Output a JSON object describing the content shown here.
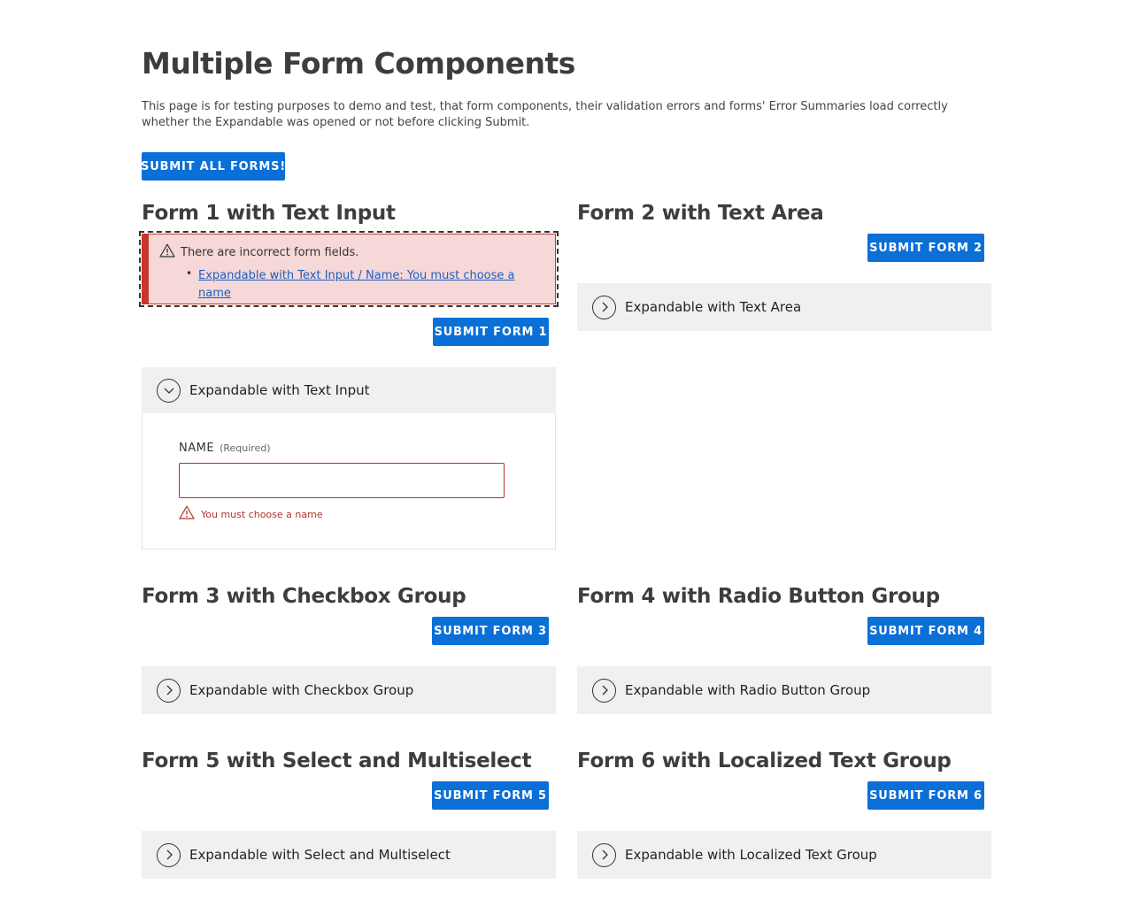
{
  "page": {
    "title": "Multiple Form Components",
    "intro": "This page is for testing purposes to demo and test, that form components, their validation errors and forms' Error Summaries load correctly whether the Expandable was opened or not before clicking Submit.",
    "submit_all_label": "SUBMIT ALL FORMS!"
  },
  "forms": [
    {
      "title": "Form 1 with Text Input",
      "submit_label": "SUBMIT FORM 1",
      "expandable_label": "Expandable with Text Input",
      "expanded": true,
      "error_summary": {
        "heading": "There are incorrect form fields.",
        "links": [
          "Expandable with Text Input / Name: You must choose a name"
        ]
      },
      "field": {
        "label": "NAME",
        "required_text": "(Required)",
        "value": "",
        "error": "You must choose a name"
      }
    },
    {
      "title": "Form 2 with Text Area",
      "submit_label": "SUBMIT FORM 2",
      "expandable_label": "Expandable with Text Area",
      "expanded": false
    },
    {
      "title": "Form 3 with Checkbox Group",
      "submit_label": "SUBMIT FORM 3",
      "expandable_label": "Expandable with Checkbox Group",
      "expanded": false
    },
    {
      "title": "Form 4 with Radio Button Group",
      "submit_label": "SUBMIT FORM 4",
      "expandable_label": "Expandable with Radio Button Group",
      "expanded": false
    },
    {
      "title": "Form 5 with Select and Multiselect",
      "submit_label": "SUBMIT FORM 5",
      "expandable_label": "Expandable with Select and Multiselect",
      "expanded": false
    },
    {
      "title": "Form 6 with Localized Text Group",
      "submit_label": "SUBMIT FORM 6",
      "expandable_label": "Expandable with Localized Text Group",
      "expanded": false
    }
  ],
  "colors": {
    "primary_button": "#0b6fd8",
    "error": "#c7352c",
    "error_summary_bg": "#f5d8d7",
    "expandable_bg": "#f0f0f0",
    "link": "#1a5fc4"
  },
  "icons": {
    "error_summary": "warning-triangle-icon",
    "field_error": "warning-triangle-icon",
    "expandable_collapsed": "chevron-right-circle-icon",
    "expandable_expanded": "chevron-down-circle-icon"
  }
}
